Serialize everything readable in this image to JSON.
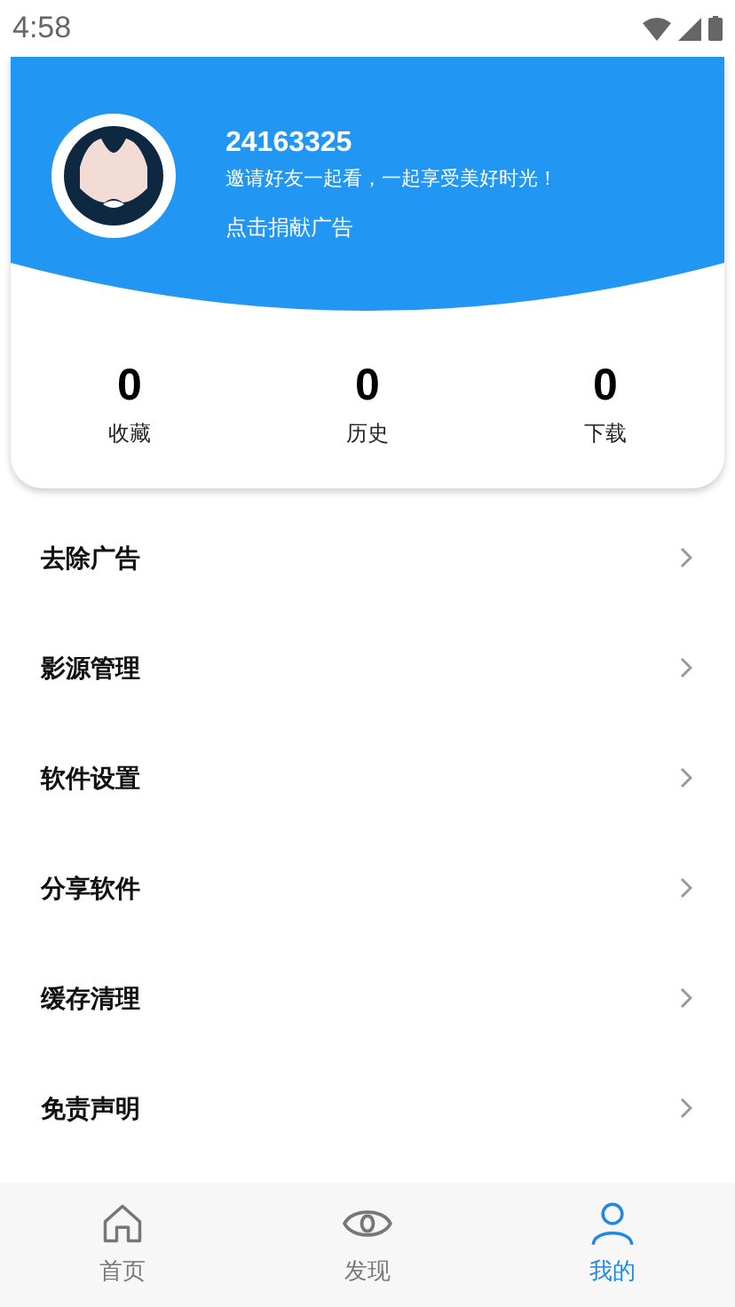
{
  "status_bar": {
    "time": "4:58"
  },
  "profile": {
    "user_id": "24163325",
    "slogan": "邀请好友一起看，一起享受美好时光！",
    "donate_link": "点击捐献广告"
  },
  "stats": [
    {
      "value": "0",
      "label": "收藏"
    },
    {
      "value": "0",
      "label": "历史"
    },
    {
      "value": "0",
      "label": "下载"
    }
  ],
  "menu": [
    {
      "label": "去除广告"
    },
    {
      "label": "影源管理"
    },
    {
      "label": "软件设置"
    },
    {
      "label": "分享软件"
    },
    {
      "label": "缓存清理"
    },
    {
      "label": "免责声明"
    }
  ],
  "bottom_nav": [
    {
      "label": "首页",
      "kind": "home",
      "selected": false
    },
    {
      "label": "发现",
      "kind": "discover",
      "selected": false
    },
    {
      "label": "我的",
      "kind": "me",
      "selected": true
    }
  ]
}
